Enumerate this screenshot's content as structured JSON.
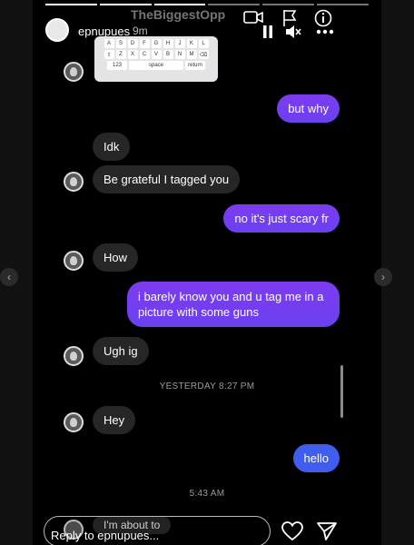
{
  "header": {
    "username": "epnupues",
    "time": "9m",
    "overlay_name": "TheBiggestOpp",
    "icons": {
      "camera": "video-camera-icon",
      "flag": "flag-icon",
      "info": "info-icon",
      "pause": "pause-icon",
      "mute": "mute-icon",
      "more": "more-options-icon"
    }
  },
  "keyboard": {
    "row1": [
      "A",
      "S",
      "D",
      "F",
      "G",
      "H",
      "J",
      "K",
      "L"
    ],
    "row2": [
      "⇧",
      "Z",
      "X",
      "C",
      "V",
      "B",
      "N",
      "M",
      "⌫"
    ],
    "row3": [
      "123",
      "space",
      "return"
    ]
  },
  "messages": [
    {
      "sender": "me",
      "text": "but why"
    },
    {
      "sender": "them",
      "text": "Idk"
    },
    {
      "sender": "them",
      "text": "Be grateful I tagged you"
    },
    {
      "sender": "me",
      "text": "no it's just scary fr"
    },
    {
      "sender": "them",
      "text": "How"
    },
    {
      "sender": "me",
      "text": "i barely know you and u tag me in a picture with some guns"
    },
    {
      "sender": "them",
      "text": "Ugh ig"
    },
    {
      "sender": "them",
      "text": "Hey"
    },
    {
      "sender": "me",
      "text": "hello"
    }
  ],
  "timestamps": [
    "YESTERDAY 8:27 PM",
    "5:43 AM"
  ],
  "reply": {
    "placeholder": "Reply to epnupues...",
    "ghost_message": "I'm about to"
  },
  "colors": {
    "sent_bubble": "#7a3cf0",
    "sent_bubble_last": "#3f5ef0",
    "received_bubble": "#262626",
    "background": "#000000"
  }
}
